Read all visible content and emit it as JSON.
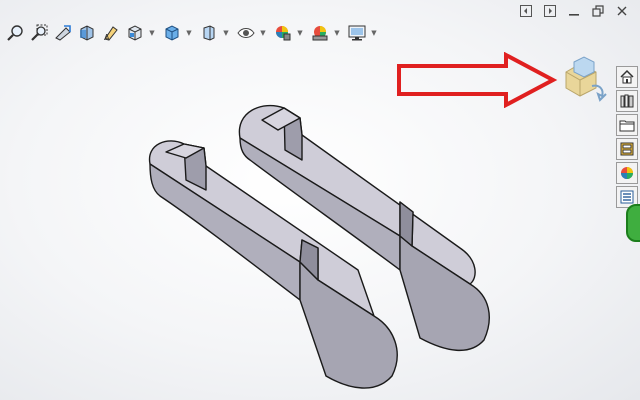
{
  "toolbar": {
    "items": [
      {
        "icon": "zoom-to-fit-icon",
        "has_menu": false
      },
      {
        "icon": "zoom-to-area-icon",
        "has_menu": false
      },
      {
        "icon": "previous-view-icon",
        "has_menu": false
      },
      {
        "icon": "section-view-icon",
        "has_menu": false
      },
      {
        "icon": "dynamic-annotation-icon",
        "has_menu": false
      },
      {
        "icon": "view-orientation-icon",
        "has_menu": true
      },
      {
        "icon": "display-style-icon",
        "has_menu": true
      },
      {
        "icon": "hide-show-items-icon",
        "has_menu": true
      },
      {
        "icon": "edit-appearance-icon",
        "has_menu": true
      },
      {
        "icon": "apply-scene-icon",
        "has_menu": true
      },
      {
        "icon": "view-settings-icon",
        "has_menu": true
      }
    ]
  },
  "window_controls": [
    "tile-left-icon",
    "tile-right-icon",
    "minimize-icon",
    "restore-icon",
    "close-icon"
  ],
  "task_pane": [
    "home-icon",
    "design-library-icon",
    "file-explorer-icon",
    "view-palette-icon",
    "appearances-icon",
    "custom-properties-icon"
  ],
  "annotation": {
    "color": "#e02020"
  },
  "model": {
    "face_color": "#b7b6c2",
    "top_color": "#cfcdd8",
    "edge_color": "#1a1a1a"
  }
}
